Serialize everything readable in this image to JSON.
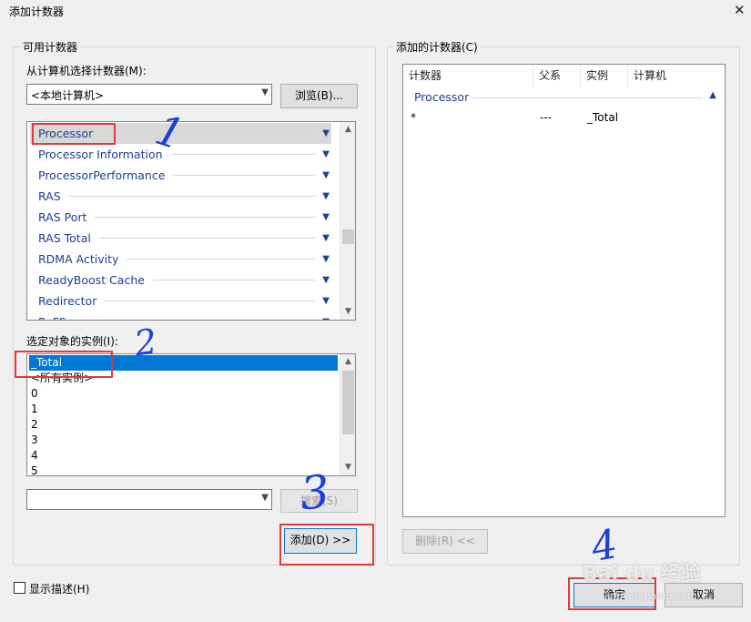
{
  "window": {
    "title": "添加计数器",
    "close_glyph": "✕"
  },
  "available": {
    "group_label": "可用计数器",
    "computer_label": "从计算机选择计数器(M):",
    "computer_value": "<本地计算机>",
    "browse_label": "浏览(B)...",
    "objects": [
      {
        "name": "Processor"
      },
      {
        "name": "Processor Information"
      },
      {
        "name": "ProcessorPerformance"
      },
      {
        "name": "RAS"
      },
      {
        "name": "RAS Port"
      },
      {
        "name": "RAS Total"
      },
      {
        "name": "RDMA Activity"
      },
      {
        "name": "ReadyBoost Cache"
      },
      {
        "name": "Redirector"
      },
      {
        "name": "ReFS"
      }
    ],
    "instances_label": "选定对象的实例(I):",
    "instances": [
      "_Total",
      "<所有实例>",
      "0",
      "1",
      "2",
      "3",
      "4",
      "5"
    ],
    "search_value": "",
    "search_label": "搜索(S)",
    "add_label": "添加(D) >>"
  },
  "added": {
    "group_label": "添加的计数器(C)",
    "columns": [
      "计数器",
      "父系",
      "实例",
      "计算机"
    ],
    "group_row": "Processor",
    "rows": [
      {
        "counter": "*",
        "parent": "---",
        "instance": "_Total",
        "computer": ""
      }
    ],
    "remove_label": "删除(R) <<"
  },
  "footer": {
    "show_desc_label": "显示描述(H)",
    "ok_label": "确定",
    "cancel_label": "取消"
  },
  "annotations": {
    "step1": "1",
    "step2": "2",
    "step3": "3",
    "step4": "4"
  },
  "watermark": {
    "brand": "Bai du 经验",
    "url": "jingyan.baidu.com"
  }
}
